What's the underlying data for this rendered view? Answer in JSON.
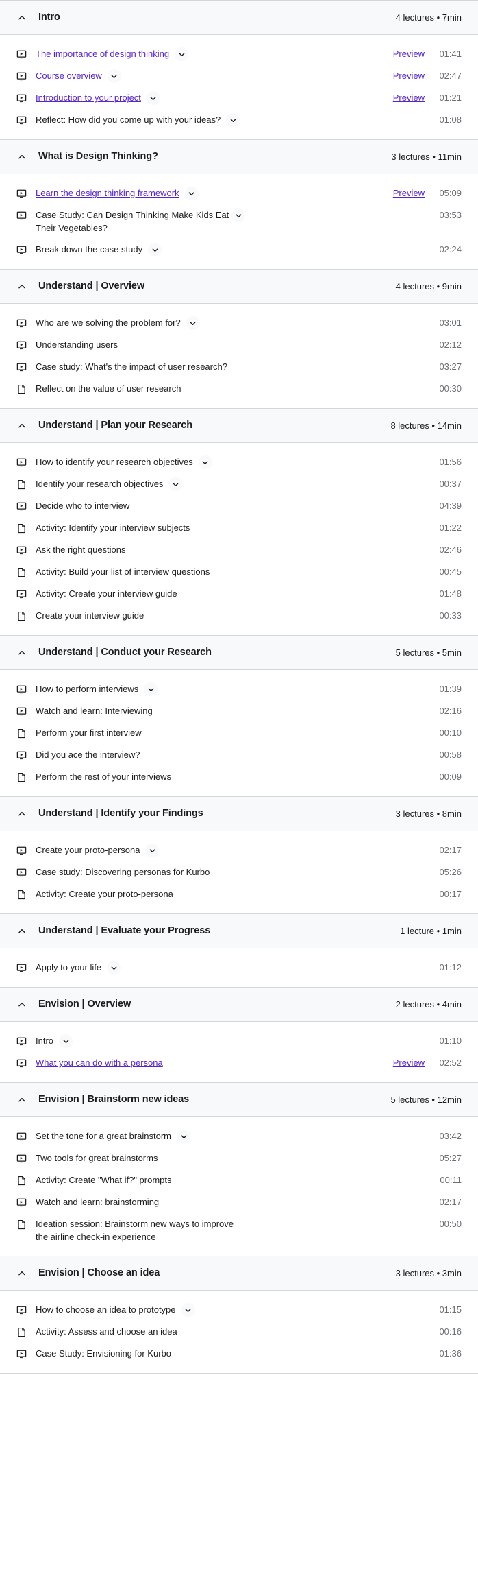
{
  "icons": {
    "collapse": "chevron-up-icon",
    "expand": "chevron-down-icon",
    "video": "video-icon",
    "article": "article-icon"
  },
  "labels": {
    "preview": "Preview"
  },
  "colors": {
    "link": "#5624d0",
    "text": "#1c1d1f",
    "muted": "#6a6f73",
    "section_bg": "#f7f9fa",
    "border": "#d1d7dc"
  },
  "sections": [
    {
      "title": "Intro",
      "meta": "4 lectures • 7min",
      "expanded": true,
      "lectures": [
        {
          "icon": "video",
          "title": "The importance of design thinking",
          "caret": true,
          "link": true,
          "preview": "Preview",
          "duration": "01:41",
          "wrap": false
        },
        {
          "icon": "video",
          "title": "Course overview",
          "caret": true,
          "link": true,
          "preview": "Preview",
          "duration": "02:47",
          "wrap": false
        },
        {
          "icon": "video",
          "title": "Introduction to your project",
          "caret": true,
          "link": true,
          "preview": "Preview",
          "duration": "01:21",
          "wrap": false
        },
        {
          "icon": "video",
          "title": "Reflect: How did you come up with your ideas?",
          "caret": true,
          "link": false,
          "preview": "",
          "duration": "01:08",
          "wrap": false
        }
      ]
    },
    {
      "title": "What is Design Thinking?",
      "meta": "3 lectures • 11min",
      "expanded": true,
      "lectures": [
        {
          "icon": "video",
          "title": "Learn the design thinking framework",
          "caret": true,
          "link": true,
          "preview": "Preview",
          "duration": "05:09",
          "wrap": false
        },
        {
          "icon": "video",
          "title": "Case Study: Can Design Thinking Make Kids Eat Their Vegetables?",
          "caret": true,
          "link": false,
          "preview": "",
          "duration": "03:53",
          "wrap": true
        },
        {
          "icon": "video",
          "title": "Break down the case study",
          "caret": true,
          "link": false,
          "preview": "",
          "duration": "02:24",
          "wrap": false
        }
      ]
    },
    {
      "title": "Understand | Overview",
      "meta": "4 lectures • 9min",
      "expanded": true,
      "lectures": [
        {
          "icon": "video",
          "title": "Who are we solving the problem for?",
          "caret": true,
          "link": false,
          "preview": "",
          "duration": "03:01",
          "wrap": false
        },
        {
          "icon": "video",
          "title": "Understanding users",
          "caret": false,
          "link": false,
          "preview": "",
          "duration": "02:12",
          "wrap": false
        },
        {
          "icon": "video",
          "title": "Case study: What's the impact of user research?",
          "caret": false,
          "link": false,
          "preview": "",
          "duration": "03:27",
          "wrap": false
        },
        {
          "icon": "article",
          "title": "Reflect on the value of user research",
          "caret": false,
          "link": false,
          "preview": "",
          "duration": "00:30",
          "wrap": false
        }
      ]
    },
    {
      "title": "Understand | Plan your Research",
      "meta": "8 lectures • 14min",
      "expanded": true,
      "lectures": [
        {
          "icon": "video",
          "title": "How to identify your research objectives",
          "caret": true,
          "link": false,
          "preview": "",
          "duration": "01:56",
          "wrap": false
        },
        {
          "icon": "article",
          "title": "Identify your research objectives",
          "caret": true,
          "link": false,
          "preview": "",
          "duration": "00:37",
          "wrap": false
        },
        {
          "icon": "video",
          "title": "Decide who to interview",
          "caret": false,
          "link": false,
          "preview": "",
          "duration": "04:39",
          "wrap": false
        },
        {
          "icon": "article",
          "title": "Activity: Identify your interview subjects",
          "caret": false,
          "link": false,
          "preview": "",
          "duration": "01:22",
          "wrap": false
        },
        {
          "icon": "video",
          "title": "Ask the right questions",
          "caret": false,
          "link": false,
          "preview": "",
          "duration": "02:46",
          "wrap": false
        },
        {
          "icon": "article",
          "title": "Activity: Build your list of interview questions",
          "caret": false,
          "link": false,
          "preview": "",
          "duration": "00:45",
          "wrap": false
        },
        {
          "icon": "video",
          "title": "Activity: Create your interview guide",
          "caret": false,
          "link": false,
          "preview": "",
          "duration": "01:48",
          "wrap": false
        },
        {
          "icon": "article",
          "title": "Create your interview guide",
          "caret": false,
          "link": false,
          "preview": "",
          "duration": "00:33",
          "wrap": false
        }
      ]
    },
    {
      "title": "Understand | Conduct your Research",
      "meta": "5 lectures • 5min",
      "expanded": true,
      "lectures": [
        {
          "icon": "video",
          "title": "How to perform interviews",
          "caret": true,
          "link": false,
          "preview": "",
          "duration": "01:39",
          "wrap": false
        },
        {
          "icon": "video",
          "title": "Watch and learn: Interviewing",
          "caret": false,
          "link": false,
          "preview": "",
          "duration": "02:16",
          "wrap": false
        },
        {
          "icon": "article",
          "title": "Perform your first interview",
          "caret": false,
          "link": false,
          "preview": "",
          "duration": "00:10",
          "wrap": false
        },
        {
          "icon": "video",
          "title": "Did you ace the interview?",
          "caret": false,
          "link": false,
          "preview": "",
          "duration": "00:58",
          "wrap": false
        },
        {
          "icon": "article",
          "title": "Perform the rest of your interviews",
          "caret": false,
          "link": false,
          "preview": "",
          "duration": "00:09",
          "wrap": false
        }
      ]
    },
    {
      "title": "Understand | Identify your Findings",
      "meta": "3 lectures • 8min",
      "expanded": true,
      "lectures": [
        {
          "icon": "video",
          "title": "Create your proto-persona",
          "caret": true,
          "link": false,
          "preview": "",
          "duration": "02:17",
          "wrap": false
        },
        {
          "icon": "video",
          "title": "Case study: Discovering personas for Kurbo",
          "caret": false,
          "link": false,
          "preview": "",
          "duration": "05:26",
          "wrap": false
        },
        {
          "icon": "article",
          "title": "Activity: Create your proto-persona",
          "caret": false,
          "link": false,
          "preview": "",
          "duration": "00:17",
          "wrap": false
        }
      ]
    },
    {
      "title": "Understand | Evaluate your Progress",
      "meta": "1 lecture • 1min",
      "expanded": true,
      "lectures": [
        {
          "icon": "video",
          "title": "Apply to your life",
          "caret": true,
          "link": false,
          "preview": "",
          "duration": "01:12",
          "wrap": false
        }
      ]
    },
    {
      "title": "Envision | Overview",
      "meta": "2 lectures • 4min",
      "expanded": true,
      "lectures": [
        {
          "icon": "video",
          "title": "Intro",
          "caret": true,
          "link": false,
          "preview": "",
          "duration": "01:10",
          "wrap": false
        },
        {
          "icon": "video",
          "title": "What you can do with a persona",
          "caret": false,
          "link": true,
          "preview": "Preview",
          "duration": "02:52",
          "wrap": false
        }
      ]
    },
    {
      "title": "Envision | Brainstorm new ideas",
      "meta": "5 lectures • 12min",
      "expanded": true,
      "lectures": [
        {
          "icon": "video",
          "title": "Set the tone for a great brainstorm",
          "caret": true,
          "link": false,
          "preview": "",
          "duration": "03:42",
          "wrap": false
        },
        {
          "icon": "video",
          "title": "Two tools for great brainstorms",
          "caret": false,
          "link": false,
          "preview": "",
          "duration": "05:27",
          "wrap": false
        },
        {
          "icon": "article",
          "title": "Activity: Create \"What if?\" prompts",
          "caret": false,
          "link": false,
          "preview": "",
          "duration": "00:11",
          "wrap": false
        },
        {
          "icon": "video",
          "title": "Watch and learn: brainstorming",
          "caret": false,
          "link": false,
          "preview": "",
          "duration": "02:17",
          "wrap": false
        },
        {
          "icon": "article",
          "title": "Ideation session: Brainstorm new ways to improve the airline check-in experience",
          "caret": false,
          "link": false,
          "preview": "",
          "duration": "00:50",
          "wrap": true
        }
      ]
    },
    {
      "title": "Envision | Choose an idea",
      "meta": "3 lectures • 3min",
      "expanded": true,
      "lectures": [
        {
          "icon": "video",
          "title": "How to choose an idea to prototype",
          "caret": true,
          "link": false,
          "preview": "",
          "duration": "01:15",
          "wrap": false
        },
        {
          "icon": "article",
          "title": "Activity: Assess and choose an idea",
          "caret": false,
          "link": false,
          "preview": "",
          "duration": "00:16",
          "wrap": false
        },
        {
          "icon": "video",
          "title": "Case Study: Envisioning for Kurbo",
          "caret": false,
          "link": false,
          "preview": "",
          "duration": "01:36",
          "wrap": false
        }
      ]
    }
  ]
}
